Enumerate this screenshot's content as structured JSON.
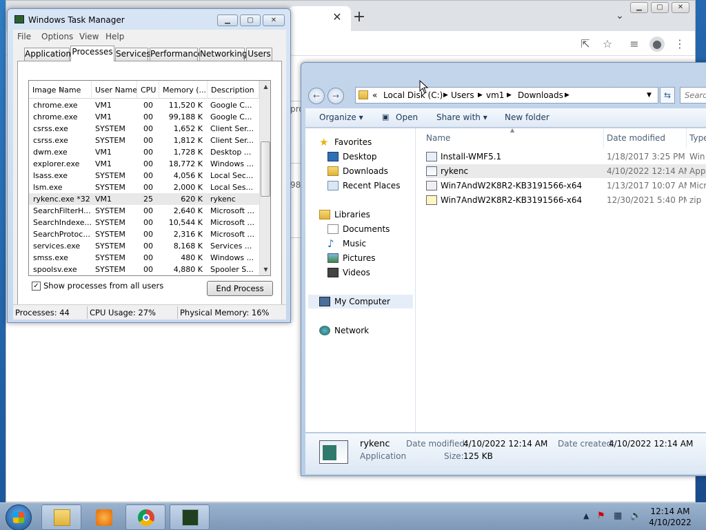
{
  "taskmgr": {
    "title": "Windows Task Manager",
    "menu": [
      "File",
      "Options",
      "View",
      "Help"
    ],
    "tabs": [
      "Applications",
      "Processes",
      "Services",
      "Performance",
      "Networking",
      "Users"
    ],
    "columns": [
      "Image Name",
      "User Name",
      "CPU",
      "Memory (...",
      "Description"
    ],
    "processes": [
      [
        "chrome.exe",
        "VM1",
        "00",
        "11,520 K",
        "Google C..."
      ],
      [
        "chrome.exe",
        "VM1",
        "00",
        "99,188 K",
        "Google C..."
      ],
      [
        "csrss.exe",
        "SYSTEM",
        "00",
        "1,652 K",
        "Client Ser..."
      ],
      [
        "csrss.exe",
        "SYSTEM",
        "00",
        "1,812 K",
        "Client Ser..."
      ],
      [
        "dwm.exe",
        "VM1",
        "00",
        "1,728 K",
        "Desktop ..."
      ],
      [
        "explorer.exe",
        "VM1",
        "00",
        "18,772 K",
        "Windows ..."
      ],
      [
        "lsass.exe",
        "SYSTEM",
        "00",
        "4,056 K",
        "Local Sec..."
      ],
      [
        "lsm.exe",
        "SYSTEM",
        "00",
        "2,000 K",
        "Local Ses..."
      ],
      [
        "rykenc.exe *32",
        "VM1",
        "25",
        "620 K",
        "rykenc"
      ],
      [
        "SearchFilterH...",
        "SYSTEM",
        "00",
        "2,640 K",
        "Microsoft ..."
      ],
      [
        "SearchIndexe...",
        "SYSTEM",
        "00",
        "10,544 K",
        "Microsoft ..."
      ],
      [
        "SearchProtoc...",
        "SYSTEM",
        "00",
        "2,316 K",
        "Microsoft ..."
      ],
      [
        "services.exe",
        "SYSTEM",
        "00",
        "8,168 K",
        "Services ..."
      ],
      [
        "smss.exe",
        "SYSTEM",
        "00",
        "480 K",
        "Windows ..."
      ],
      [
        "spoolsv.exe",
        "SYSTEM",
        "00",
        "4,880 K",
        "Spooler S..."
      ]
    ],
    "show_all_label": "Show processes from all users",
    "end_process_label": "End Process",
    "status": {
      "processes": "Processes: 44",
      "cpu": "CPU Usage: 27%",
      "memory": "Physical Memory: 16%"
    }
  },
  "explorer": {
    "breadcrumb": [
      "«",
      "Local Disk (C:)",
      "Users",
      "vm1",
      "Downloads"
    ],
    "search_placeholder": "Search",
    "commands": {
      "organize": "Organize ▾",
      "open": "Open",
      "share": "Share with ▾",
      "new_folder": "New folder"
    },
    "nav": {
      "favorites": "Favorites",
      "desktop": "Desktop",
      "downloads": "Downloads",
      "recent": "Recent Places",
      "libraries": "Libraries",
      "documents": "Documents",
      "music": "Music",
      "pictures": "Pictures",
      "videos": "Videos",
      "computer": "My Computer",
      "network": "Network"
    },
    "columns": {
      "name": "Name",
      "date": "Date modified",
      "type": "Type"
    },
    "files": [
      [
        "Install-WMF5.1",
        "1/18/2017 3:25 PM",
        "Win"
      ],
      [
        "rykenc",
        "4/10/2022 12:14 AM",
        "App"
      ],
      [
        "Win7AndW2K8R2-KB3191566-x64",
        "1/13/2017 10:07 AM",
        "Micr"
      ],
      [
        "Win7AndW2K8R2-KB3191566-x64",
        "12/30/2021 5:40 PM",
        "zip"
      ]
    ],
    "details": {
      "name": "rykenc",
      "type": "Application",
      "modified_label": "Date modified:",
      "modified_value": "4/10/2022 12:14 AM",
      "created_label": "Date created:",
      "created_value": "4/10/2022 12:14 AM",
      "size_label": "Size:",
      "size_value": "125 KB"
    }
  },
  "chrome": {
    "frag1": "pro",
    "frag2": "98"
  },
  "taskbar": {
    "time": "12:14 AM",
    "date": "4/10/2022"
  }
}
